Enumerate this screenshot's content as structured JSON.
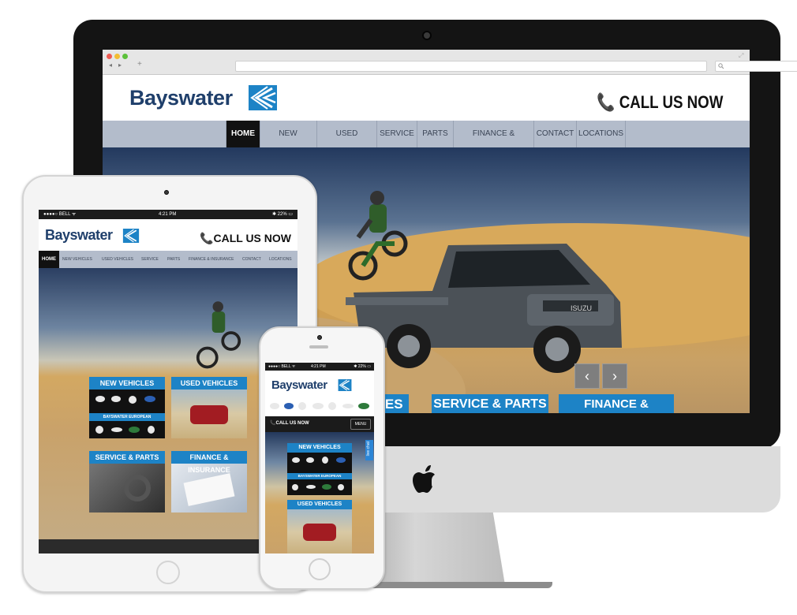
{
  "brand": {
    "name": "Bayswater",
    "call_label": "CALL US NOW",
    "accent_color": "#1d83c6",
    "text_color": "#1f3f6b"
  },
  "browser": {
    "new_tab_symbol": "+",
    "back_symbol": "◂",
    "forward_symbol": "▸",
    "search_icon": "search-icon"
  },
  "desktop": {
    "nav": [
      {
        "label": "HOME",
        "active": true
      },
      {
        "label": "NEW VEHICLES",
        "active": false
      },
      {
        "label": "USED VEHICLES",
        "active": false
      },
      {
        "label": "SERVICE",
        "active": false
      },
      {
        "label": "PARTS",
        "active": false
      },
      {
        "label": "FINANCE & INSURANCE",
        "active": false
      },
      {
        "label": "CONTACT",
        "active": false
      },
      {
        "label": "LOCATIONS",
        "active": false
      }
    ],
    "banners": [
      "LES",
      "SERVICE & PARTS",
      "FINANCE & INSURANCE"
    ],
    "prev_arrow": "‹",
    "next_arrow": "›",
    "truck_badge": "ISUZU"
  },
  "tablet": {
    "status": {
      "carrier": "●●●●○ BELL ᯤ",
      "time": "4:21 PM",
      "battery": "✱ 22% ▭"
    },
    "nav": [
      "HOME",
      "NEW VEHICLES",
      "USED VEHICLES",
      "SERVICE",
      "PARTS",
      "FINANCE & INSURANCE",
      "CONTACT",
      "LOCATIONS"
    ],
    "tiles": {
      "new_vehicles": "NEW VEHICLES",
      "used_vehicles": "USED VEHICLES",
      "european": "BAYSWATER EUROPEAN",
      "service_parts": "SERVICE & PARTS",
      "finance": "FINANCE & INSURANCE"
    }
  },
  "phone": {
    "status": {
      "carrier": "●●●●○ BELL ᯤ",
      "time": "4:21 PM",
      "battery": "✱ 22% ▭"
    },
    "call_label": "CALL US NOW",
    "menu_label": "MENU",
    "live_chat": "live chat",
    "tiles": {
      "new_vehicles": "NEW VEHICLES",
      "european": "BAYSWATER EUROPEAN",
      "used_vehicles": "USED VEHICLES"
    }
  }
}
